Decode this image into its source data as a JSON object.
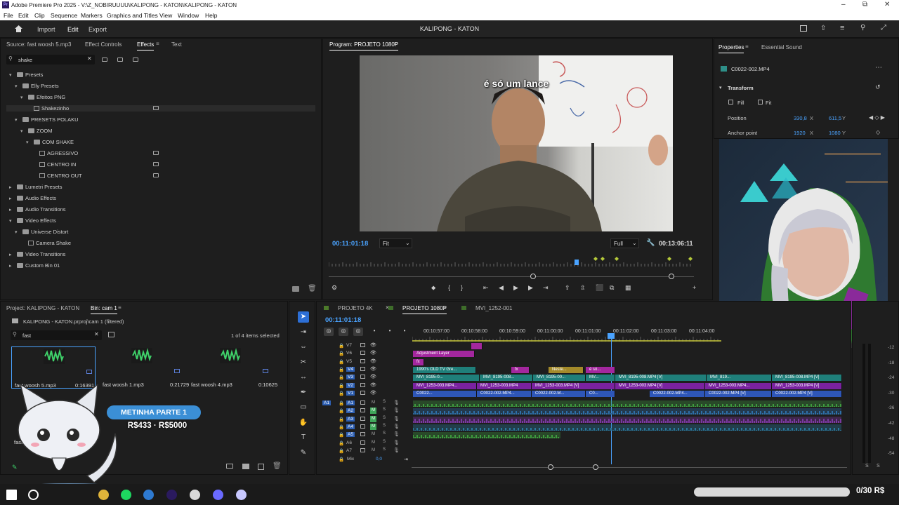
{
  "window": {
    "title": "Adobe Premiere Pro 2025 - V:\\Z_NOBIRUUUU\\KALIPONG - KATON\\KALIPONG - KATON",
    "app_icon": "Pr"
  },
  "menu": [
    "File",
    "Edit",
    "Clip",
    "Sequence",
    "Markers",
    "Graphics and Titles",
    "View",
    "Window",
    "Help"
  ],
  "header": {
    "workspaces": [
      "Import",
      "Edit",
      "Export"
    ],
    "active": "Edit",
    "project_title": "KALIPONG - KATON"
  },
  "effects_panel": {
    "tabs": [
      "Source: fast woosh 5.mp3",
      "Effect Controls",
      "Effects",
      "Text"
    ],
    "active_tab": "Effects",
    "search_value": "shake",
    "tree": [
      {
        "label": "Presets",
        "level": 0,
        "type": "folder",
        "open": true
      },
      {
        "label": "Elly Presets",
        "level": 1,
        "type": "folder",
        "open": true
      },
      {
        "label": "Efeitos PNG",
        "level": 2,
        "type": "folder",
        "open": true
      },
      {
        "label": "Shakezinho",
        "level": 3,
        "type": "preset",
        "badge": true,
        "selected": true
      },
      {
        "label": "PRESETS POLAKU",
        "level": 1,
        "type": "folder",
        "open": true
      },
      {
        "label": "ZOOM",
        "level": 2,
        "type": "folder",
        "open": true
      },
      {
        "label": "COM SHAKE",
        "level": 3,
        "type": "folder",
        "open": true
      },
      {
        "label": "AGRESSIVO",
        "level": 4,
        "type": "preset",
        "badge": true
      },
      {
        "label": "CENTRO IN",
        "level": 4,
        "type": "preset",
        "badge": true
      },
      {
        "label": "CENTRO OUT",
        "level": 4,
        "type": "preset",
        "badge": true
      },
      {
        "label": "Lumetri Presets",
        "level": 0,
        "type": "folder",
        "open": false
      },
      {
        "label": "Audio Effects",
        "level": 0,
        "type": "folder",
        "open": false
      },
      {
        "label": "Audio Transitions",
        "level": 0,
        "type": "folder",
        "open": false
      },
      {
        "label": "Video Effects",
        "level": 0,
        "type": "folder",
        "open": true
      },
      {
        "label": "Universe Distort",
        "level": 1,
        "type": "folder",
        "open": true
      },
      {
        "label": "Camera Shake",
        "level": 2,
        "type": "preset"
      },
      {
        "label": "Video Transitions",
        "level": 0,
        "type": "folder",
        "open": false
      },
      {
        "label": "Custom Bin 01",
        "level": 0,
        "type": "folder",
        "open": false
      }
    ]
  },
  "program_monitor": {
    "title": "Program: PROJETO 1080P",
    "caption": "é só um lance",
    "timecode": "00:11:01:18",
    "fit": "Fit",
    "quality": "Full",
    "duration": "00:13:06:11"
  },
  "properties": {
    "tabs": [
      "Properties",
      "Essential Sound"
    ],
    "clip_name": "C0022-002.MP4",
    "section": "Transform",
    "fill_label": "Fill",
    "fit_label": "Fit",
    "position_label": "Position",
    "position_x": "330,8",
    "position_y": "611,5",
    "anchor_label": "Anchor point",
    "anchor_x": "1920",
    "anchor_y": "1080",
    "x_unit": "X",
    "y_unit": "Y"
  },
  "project_panel": {
    "tabs": [
      "Project: KALIPONG - KATON",
      "Bin: cam 1"
    ],
    "path": "KALIPONG - KATON.prproj\\cam 1 (filtered)",
    "search_value": "fast",
    "items_count": "1 of 4 items selected",
    "items": [
      {
        "name": "fast woosh 5.mp3",
        "duration": "0:16391"
      },
      {
        "name": "fast woosh 1.mp3",
        "duration": "0:21729"
      },
      {
        "name": "fast woosh 4.mp3",
        "duration": "0:10625"
      },
      {
        "name": "fast woosh 3.mp3",
        "duration": ""
      }
    ]
  },
  "overlay": {
    "badge_title": "METINHA PARTE 1",
    "badge_sub": "R$433 · R$5000",
    "goal_text": "0/30 R$"
  },
  "timeline": {
    "tabs": [
      "PROJETO 4K",
      "PROJETO 1080P",
      "MVI_1252-001"
    ],
    "active_tab": "PROJETO 1080P",
    "timecode": "00:11:01:18",
    "ruler": [
      "00:10:57:00",
      "00:10:58:00",
      "00:10:59:00",
      "00:11:00:00",
      "00:11:01:00",
      "00:11:02:00",
      "00:11:03:00",
      "00:11:04:00"
    ],
    "video_tracks": [
      "V7",
      "V6",
      "V5",
      "V4",
      "V3",
      "V2",
      "V1"
    ],
    "audio_tracks": [
      "A1",
      "A2",
      "A3",
      "A4",
      "A5",
      "A6",
      "A7"
    ],
    "mix_label": "Mix",
    "mix_value": "0,0",
    "clips": {
      "adjustment": "Adjustment Layer",
      "tv_green": "1990's OLD TV Gre...",
      "neste": "Neste...",
      "e_so": "é só...",
      "v3": [
        "MVI_8195-0...",
        "MVI_8195-008...",
        "MVI_8195-00...",
        "MV...",
        "MVI_8195-008.MP4 [V]",
        "MVI_819...",
        "MVI_8195-008.MP4 [V]"
      ],
      "v2": [
        "MVI_1253-003.MP4...",
        "MVI_1253-003.MP4",
        "MVI_1253-003.MP4 [V]",
        "MVI_1253-003.MP4 [V]",
        "MVI_1253-003.MP4...",
        "MVI_1253-003.MP4 [V]"
      ],
      "v1": [
        "C0022...",
        "C0022-002.MP4...",
        "C0022-002.M...",
        "C0...",
        "C0022-002.MP4...",
        "C0022-002.MP4 [V]",
        "C0022-002.MP4 [V]"
      ]
    }
  },
  "taskbar": [
    "start-icon",
    "search-icon",
    "chrome-icon",
    "spotify-icon",
    "terminal-icon",
    "premiere-icon",
    "obs-icon",
    "app-icon",
    "bubble-icon"
  ]
}
